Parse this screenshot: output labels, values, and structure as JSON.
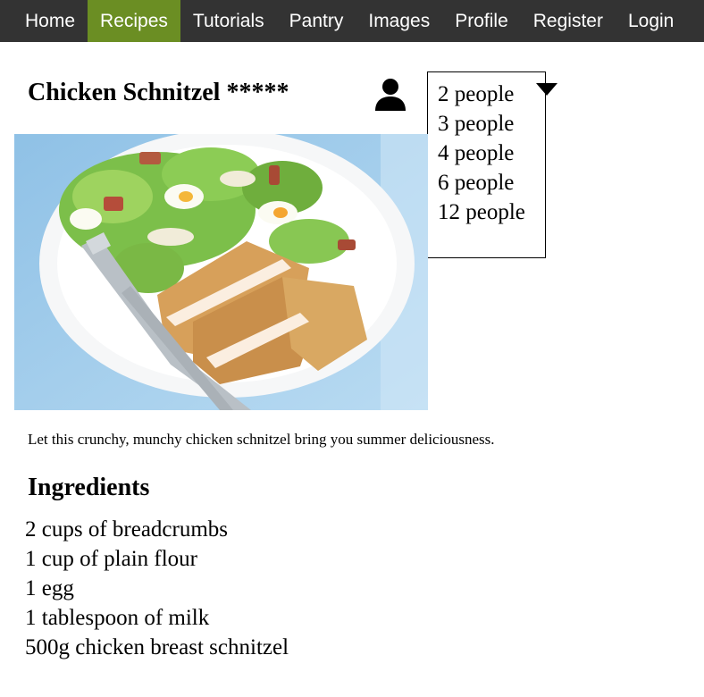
{
  "nav": {
    "items": [
      {
        "label": "Home"
      },
      {
        "label": "Recipes",
        "active": true
      },
      {
        "label": "Tutorials"
      },
      {
        "label": "Pantry"
      },
      {
        "label": "Images"
      },
      {
        "label": "Profile"
      },
      {
        "label": "Register"
      },
      {
        "label": "Login"
      }
    ]
  },
  "recipe": {
    "title": "Chicken Schnitzel *****",
    "description": "Let this crunchy, munchy chicken schnitzel bring you summer deliciousness."
  },
  "servings": {
    "icon": "person-icon",
    "options": [
      "2 people",
      "3 people",
      "4 people",
      "6 people",
      "12 people"
    ]
  },
  "ingredients": {
    "heading": "Ingredients",
    "items": [
      "2 cups of breadcrumbs",
      "1 cup of plain flour",
      "1 egg",
      "1 tablespoon of milk",
      "500g chicken breast schnitzel"
    ]
  },
  "colors": {
    "navbar": "#333333",
    "nav_active": "#6b8e23",
    "nav_text": "#ffffff"
  }
}
